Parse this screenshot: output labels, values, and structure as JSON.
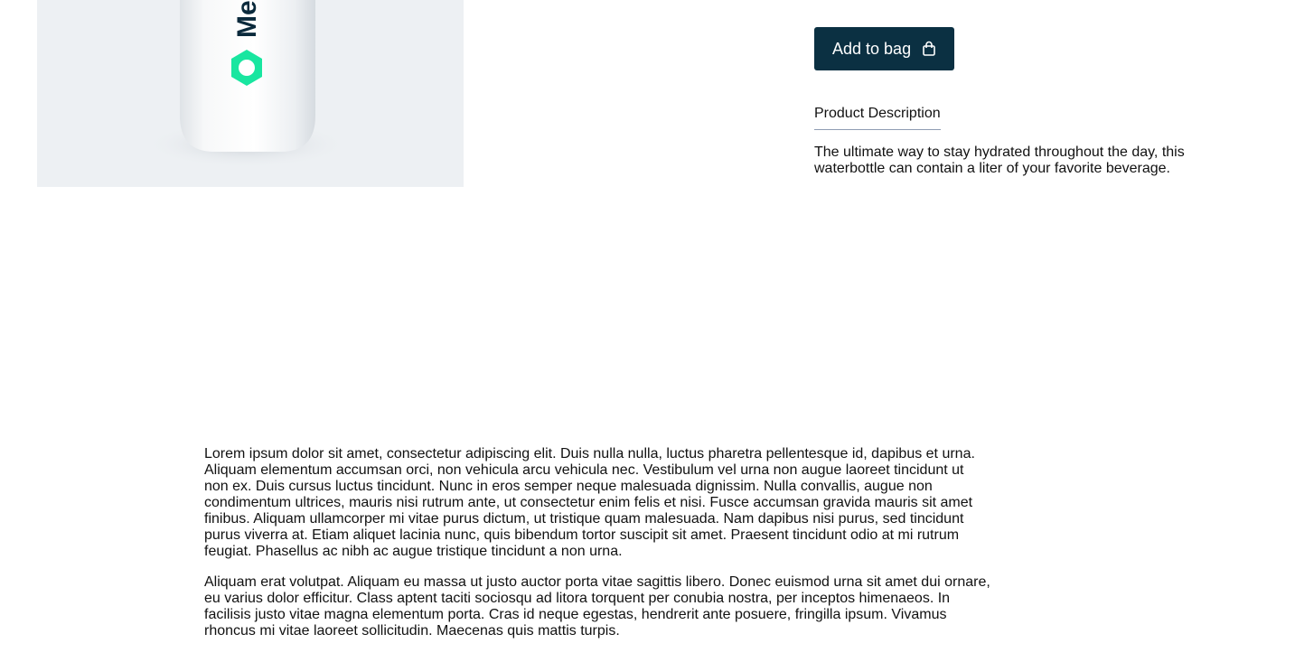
{
  "colors": {
    "accent": "#0b3042",
    "image_bg": "#edf0f3",
    "logo_green": "#19e6a0",
    "logo_text": "#0b2a3c"
  },
  "product_image": {
    "brand_text": "Me"
  },
  "buy": {
    "add_to_bag_label": "Add to bag",
    "bag_icon": "shopping-bag-icon"
  },
  "description": {
    "tab_label": "Product Description",
    "text": "The ultimate way to stay hydrated throughout the day, this waterbottle can contain a liter of your favorite beverage."
  },
  "details": {
    "paragraphs": [
      "Lorem ipsum dolor sit amet, consectetur adipiscing elit. Duis nulla nulla, luctus pharetra pellentesque id, dapibus et urna. Aliquam elementum accumsan orci, non vehicula arcu vehicula nec. Vestibulum vel urna non augue laoreet tincidunt ut non ex. Duis cursus luctus tincidunt. Nunc in eros semper neque malesuada dignissim. Nulla convallis, augue non condimentum ultrices, mauris nisi rutrum ante, ut consectetur enim felis et nisi. Fusce accumsan gravida mauris sit amet finibus. Aliquam ullamcorper mi vitae purus dictum, ut tristique quam malesuada. Nam dapibus nisi purus, sed tincidunt purus viverra at. Etiam aliquet lacinia nunc, quis bibendum tortor suscipit sit amet. Praesent tincidunt odio at mi rutrum feugiat. Phasellus ac nibh ac augue tristique tincidunt a non urna.",
      "Aliquam erat volutpat. Aliquam eu massa ut justo auctor porta vitae sagittis libero. Donec euismod urna sit amet dui ornare, eu varius dolor efficitur. Class aptent taciti sociosqu ad litora torquent per conubia nostra, per inceptos himenaeos. In facilisis justo vitae magna elementum porta. Cras id neque egestas, hendrerit ante posuere, fringilla ipsum. Vivamus rhoncus mi vitae laoreet sollicitudin. Maecenas quis mattis turpis."
    ]
  }
}
